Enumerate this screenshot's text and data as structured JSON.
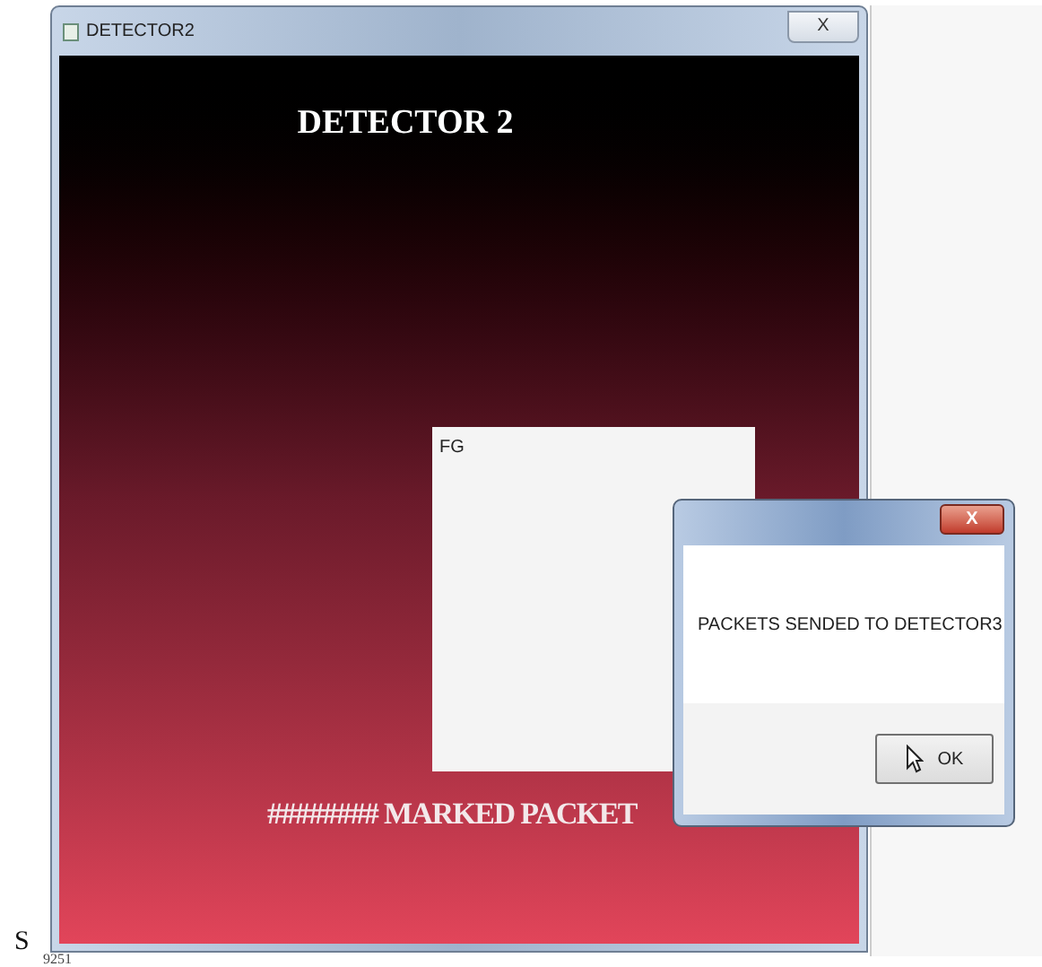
{
  "window": {
    "title": "DETECTOR2",
    "close": "X"
  },
  "heading": "DETECTOR 2",
  "text_area": {
    "value": "FG"
  },
  "footer_text": "######## MARKED PACKET",
  "dialog": {
    "close": "X",
    "message": "PACKETS SENDED TO DETECTOR3",
    "buttons": [
      "OK"
    ]
  },
  "page_letter": "S",
  "page_number": "9251"
}
